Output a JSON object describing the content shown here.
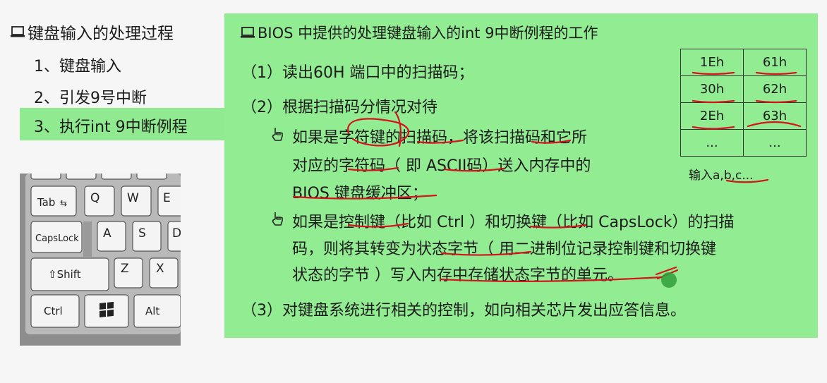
{
  "nav": {
    "title": "键盘输入的处理过程",
    "items": [
      {
        "label": "1、键盘输入"
      },
      {
        "label": "2、引发9号中断"
      },
      {
        "label": "3、执行int 9中断例程"
      }
    ]
  },
  "keyboard": {
    "keys": [
      "Tab",
      "Q",
      "W",
      "E",
      "CapsLock",
      "A",
      "S",
      "D",
      "⇧Shift",
      "Z",
      "X",
      "Ctrl",
      "Alt"
    ]
  },
  "panel": {
    "title": "BIOS 中提供的处理键盘输入的int 9中断例程的工作",
    "step1": "（1）读出60H 端口中的扫描码；",
    "step2": "（2）根据扫描码分情况对待",
    "b1_line1": "如果是字符键的扫描码，将该扫描码和它所",
    "b1_line2": "对应的字符码（ 即 ASCII码）送入内存中的",
    "b1_line3": "BIOS 键盘缓冲区；",
    "b2_line1": "如果是控制键（比如 Ctrl ）和切换键（比如 CapsLock）的扫描",
    "b2_line2": "码，则将其转变为状态字节（ 用二进制位记录控制键和切换键",
    "b2_line3": "状态的字节 ）写入内存中存储状态字节的单元。",
    "step3": "（3）对键盘系统进行相关的控制，如向相关芯片发出应答信息。"
  },
  "scan_table": {
    "rows": [
      [
        "1Eh",
        "61h"
      ],
      [
        "30h",
        "62h"
      ],
      [
        "2Eh",
        "63h"
      ],
      [
        "...",
        "..."
      ]
    ],
    "caption": "输入a,b,c..."
  },
  "colors": {
    "highlight_green": "#92ec92",
    "annotation_red": "#d4141c",
    "cursor_green": "#2e9e3a"
  }
}
